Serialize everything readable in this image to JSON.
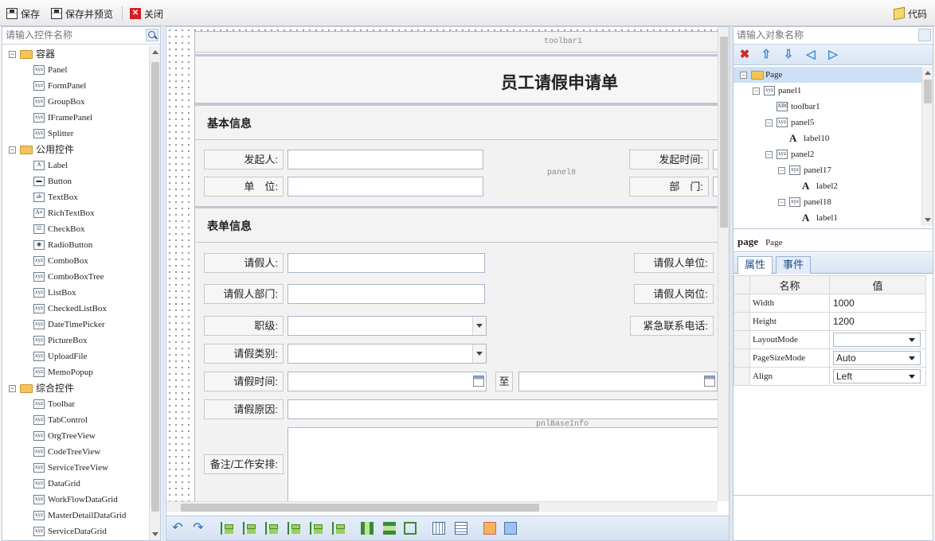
{
  "toolbar": {
    "save": "保存",
    "save_preview": "保存并预览",
    "close": "关闭",
    "code": "代码"
  },
  "left": {
    "search_placeholder": "请输入控件名称",
    "groups": [
      {
        "label": "容器",
        "items": [
          "Panel",
          "FormPanel",
          "GroupBox",
          "IFramePanel",
          "Splitter"
        ]
      },
      {
        "label": "公用控件",
        "items": [
          "Label",
          "Button",
          "TextBox",
          "RichTextBox",
          "CheckBox",
          "RadioButton",
          "ComboBox",
          "ComboBoxTree",
          "ListBox",
          "CheckedListBox",
          "DateTimePicker",
          "PictureBox",
          "UploadFile",
          "MemoPopup"
        ]
      },
      {
        "label": "综合控件",
        "items": [
          "Toolbar",
          "TabControl",
          "OrgTreeView",
          "CodeTreeView",
          "ServiceTreeView",
          "DataGrid",
          "WorkFlowDataGrid",
          "MasterDetailDataGrid",
          "ServiceDataGrid"
        ]
      }
    ]
  },
  "form": {
    "toolbar_caption": "toolbar1",
    "title": "员工请假申请单",
    "section1": "基本信息",
    "panel8_caption": "panel8",
    "initiator": "发起人:",
    "start_time": "发起时间:",
    "unit": "单　位:",
    "dept": "部　门:",
    "section2": "表单信息",
    "applicant": "请假人:",
    "applicant_unit": "请假人单位:",
    "applicant_dept": "请假人部门:",
    "applicant_post": "请假人岗位:",
    "rank": "职级:",
    "emergency": "紧急联系电话:",
    "leave_type": "请假类别:",
    "leave_time": "请假时间:",
    "to": "至",
    "reason": "请假原因:",
    "remark": "备注/工作安排:",
    "pnl_caption": "pnlBaseInfo"
  },
  "right": {
    "search_placeholder": "请输入对象名称",
    "tree": [
      {
        "label": "Page",
        "level": 0,
        "kind": "folder"
      },
      {
        "label": "panel1",
        "level": 1,
        "kind": "panel"
      },
      {
        "label": "toolbar1",
        "level": 2,
        "kind": "toolbar"
      },
      {
        "label": "panel5",
        "level": 2,
        "kind": "panel"
      },
      {
        "label": "label10",
        "level": 3,
        "kind": "label"
      },
      {
        "label": "panel2",
        "level": 2,
        "kind": "panel"
      },
      {
        "label": "panel17",
        "level": 3,
        "kind": "panel"
      },
      {
        "label": "label2",
        "level": 4,
        "kind": "label"
      },
      {
        "label": "panel18",
        "level": 3,
        "kind": "panel"
      },
      {
        "label": "label1",
        "level": 4,
        "kind": "label"
      }
    ],
    "selected_name": "page",
    "selected_type": "Page",
    "tab_props": "属性",
    "tab_events": "事件",
    "col_name": "名称",
    "col_value": "值",
    "props": [
      {
        "name": "Width",
        "value": "1000"
      },
      {
        "name": "Height",
        "value": "1200"
      },
      {
        "name": "LayoutMode",
        "value": ""
      },
      {
        "name": "PageSizeMode",
        "value": "Auto"
      },
      {
        "name": "Align",
        "value": "Left"
      }
    ]
  }
}
